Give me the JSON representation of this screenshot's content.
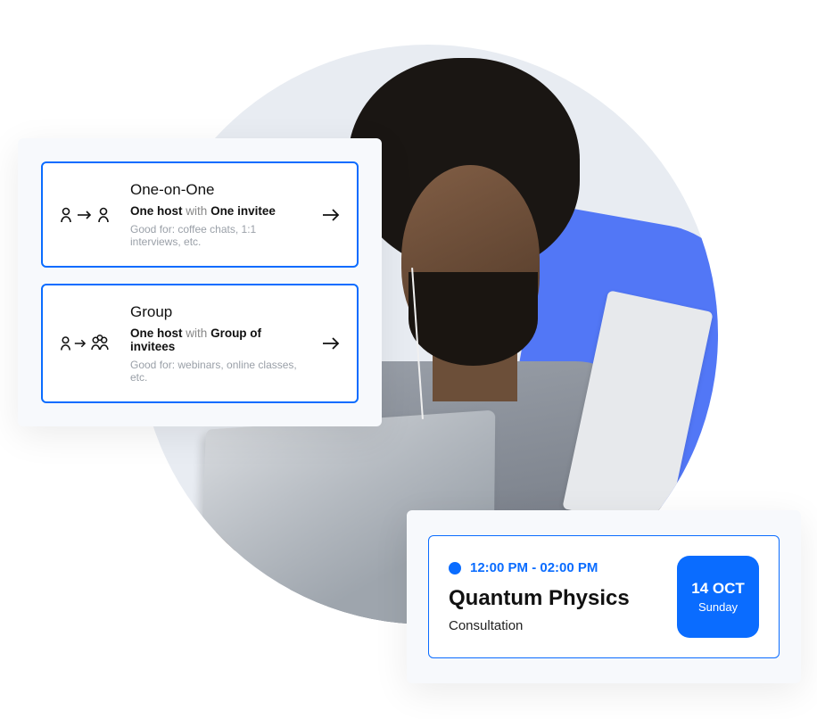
{
  "types": [
    {
      "title": "One-on-One",
      "host": "One host",
      "with": "with",
      "invitee": "One invitee",
      "note": "Good for: coffee chats, 1:1 interviews, etc."
    },
    {
      "title": "Group",
      "host": "One host",
      "with": "with",
      "invitee": "Group of invitees",
      "note": "Good for: webinars, online classes, etc."
    }
  ],
  "event": {
    "time": "12:00 PM - 02:00 PM",
    "title": "Quantum Physics",
    "subtitle": "Consultation",
    "date": "14 OCT",
    "day": "Sunday"
  },
  "colors": {
    "primary": "#0a6cff"
  }
}
